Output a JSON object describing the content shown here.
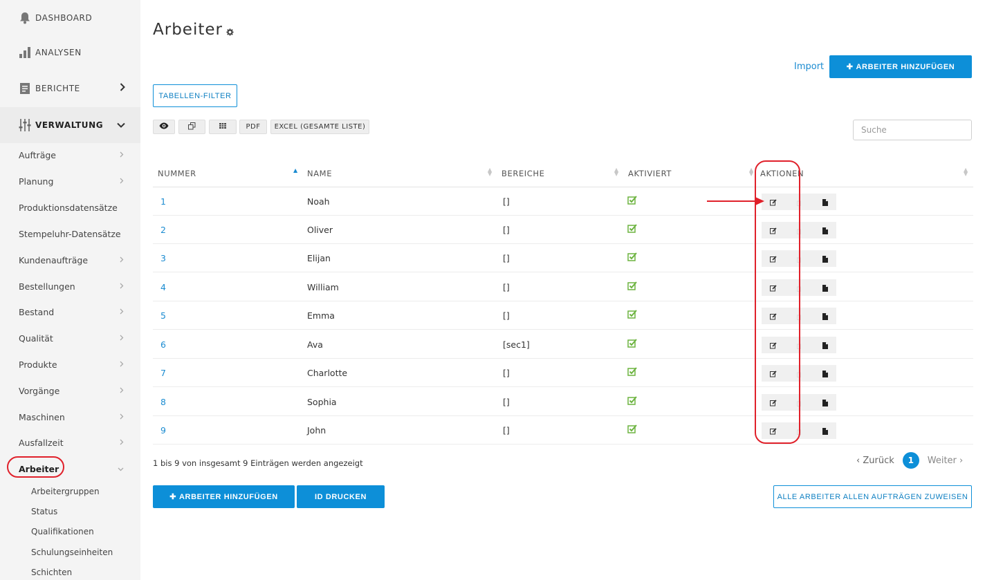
{
  "sidebar": {
    "top_items": [
      {
        "label": "DASHBOARD",
        "icon": "bell-icon"
      },
      {
        "label": "ANALYSEN",
        "icon": "bar-chart-icon"
      },
      {
        "label": "BERICHTE",
        "icon": "document-icon"
      },
      {
        "label": "VERWALTUNG",
        "icon": "sliders-icon"
      }
    ],
    "menu_items": [
      {
        "label": "Aufträge",
        "has_chevron": true
      },
      {
        "label": "Planung",
        "has_chevron": true
      },
      {
        "label": "Produktionsdatensätze",
        "has_chevron": false
      },
      {
        "label": "Stempeluhr-Datensätze",
        "has_chevron": false
      },
      {
        "label": "Kundenaufträge",
        "has_chevron": true
      },
      {
        "label": "Bestellungen",
        "has_chevron": true
      },
      {
        "label": "Bestand",
        "has_chevron": true
      },
      {
        "label": "Qualität",
        "has_chevron": true
      },
      {
        "label": "Produkte",
        "has_chevron": true
      },
      {
        "label": "Vorgänge",
        "has_chevron": true
      },
      {
        "label": "Maschinen",
        "has_chevron": true
      },
      {
        "label": "Ausfallzeit",
        "has_chevron": true
      },
      {
        "label": "Arbeiter",
        "has_chevron": true,
        "active": true
      }
    ],
    "sub_items": [
      "Arbeitergruppen",
      "Status",
      "Qualifikationen",
      "Schulungseinheiten",
      "Schichten"
    ]
  },
  "page": {
    "title": "Arbeiter",
    "import_label": "Import",
    "add_worker_top_label": "ARBEITER HINZUFÜGEN",
    "table_filter_label": "TABELLEN-FILTER",
    "toolbar": {
      "pdf_label": "PDF",
      "excel_label": "EXCEL (GESAMTE LISTE)"
    },
    "search_placeholder": "Suche"
  },
  "table": {
    "columns": [
      "NUMMER",
      "NAME",
      "BEREICHE",
      "AKTIVIERT",
      "AKTIONEN"
    ],
    "rows": [
      {
        "number": "1",
        "name": "Noah",
        "areas": "[]",
        "activated": true
      },
      {
        "number": "2",
        "name": "Oliver",
        "areas": "[]",
        "activated": true
      },
      {
        "number": "3",
        "name": "Elijan",
        "areas": "[]",
        "activated": true
      },
      {
        "number": "4",
        "name": "William",
        "areas": "[]",
        "activated": true
      },
      {
        "number": "5",
        "name": "Emma",
        "areas": "[]",
        "activated": true
      },
      {
        "number": "6",
        "name": "Ava",
        "areas": "[sec1]",
        "activated": true
      },
      {
        "number": "7",
        "name": "Charlotte",
        "areas": "[]",
        "activated": true
      },
      {
        "number": "8",
        "name": "Sophia",
        "areas": "[]",
        "activated": true
      },
      {
        "number": "9",
        "name": "John",
        "areas": "[]",
        "activated": true
      }
    ],
    "info": "1 bis 9 von insgesamt 9 Einträgen werden angezeigt"
  },
  "pagination": {
    "prev_label": "Zurück",
    "current": "1",
    "next_label": "Weiter"
  },
  "footer": {
    "add_worker_label": "ARBEITER HINZUFÜGEN",
    "print_id_label": "ID DRUCKEN",
    "assign_all_label": "ALLE ARBEITER ALLEN AUFTRÄGEN ZUWEISEN"
  },
  "colors": {
    "accent": "#0d8fd8",
    "link": "#1a8bd1",
    "check": "#6cb33f",
    "annotation": "#e0202a",
    "sidebar_bg": "#f4f4f4"
  }
}
